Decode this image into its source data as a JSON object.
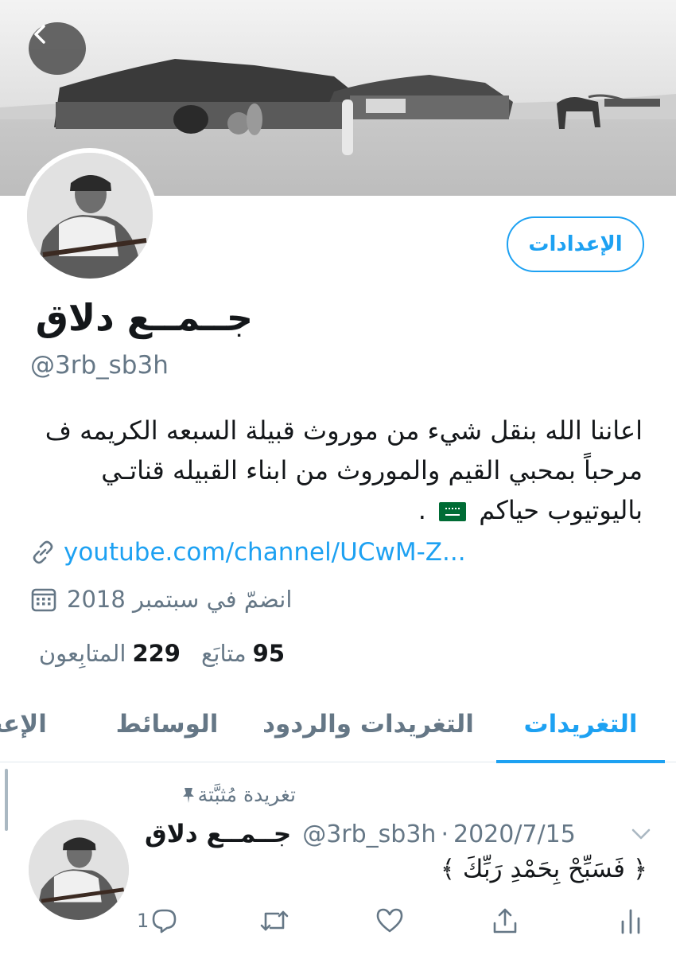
{
  "profile": {
    "settings_label": "الإعدادات",
    "display_name": "جــمــع دلاق",
    "handle": "@3rb_sb3h",
    "bio_lines": [
      "اعاننا الله بنقل شيء من موروث قبيلة السبعه الكريمه ف",
      "مرحباً بمحبي القيم والموروث من ابناء القبيله قناتـي",
      "باليوتيوب حياكم"
    ],
    "bio_end": ".",
    "link": "youtube.com/channel/UCwM-Z...",
    "joined": "انضمّ في سبتمبر 2018",
    "following_count": "95",
    "following_label": "متابَع",
    "followers_count": "229",
    "followers_label": "المتابِعون"
  },
  "tabs": [
    {
      "label": "التغريدات"
    },
    {
      "label": "التغريدات والردود"
    },
    {
      "label": "الوسائط"
    },
    {
      "label": "الإعجا"
    }
  ],
  "tweet": {
    "pinned_label": "تغريدة مُثبَّتة",
    "name": "جــمــع دلاق",
    "handle": "@3rb_sb3h",
    "separator": "·",
    "date": "2020/7/15",
    "text": "﴿ فَسَبِّحْ بِحَمْدِ رَبِّكَ ﴾",
    "reply_count": "1"
  },
  "icons": {
    "back": "chevron-left-icon",
    "link": "link-icon",
    "calendar": "calendar-icon",
    "pin": "pin-icon",
    "reply": "reply-icon",
    "retweet": "retweet-icon",
    "like": "heart-icon",
    "share": "share-icon",
    "analytics": "analytics-icon",
    "flag": "saudi-flag-emoji"
  },
  "colors": {
    "accent": "#1da1f2",
    "secondary_text": "#657786",
    "text": "#14171a"
  }
}
